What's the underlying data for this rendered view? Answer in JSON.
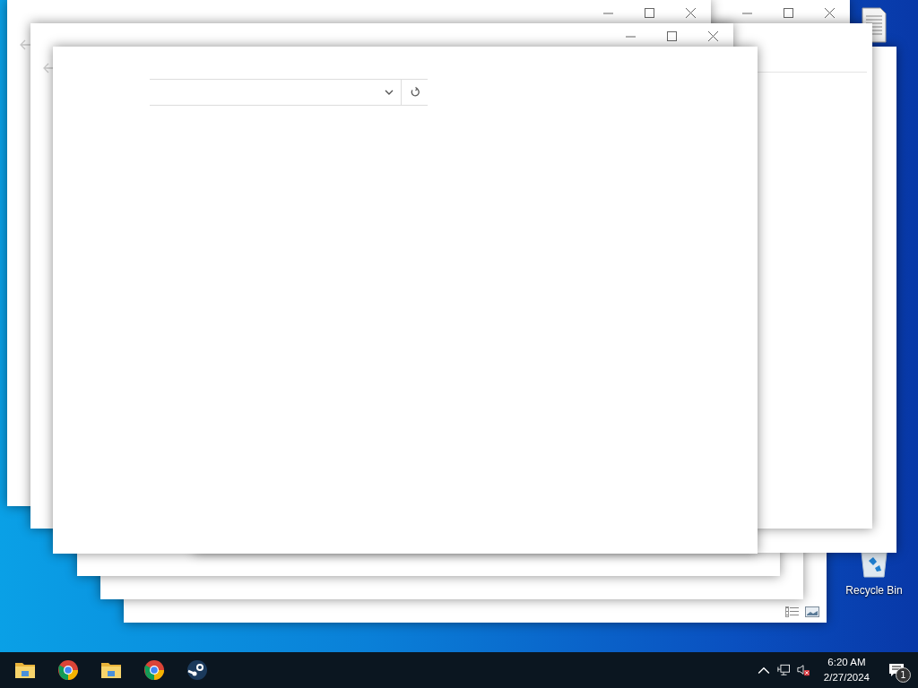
{
  "windows": [
    {
      "kind": "status"
    },
    {
      "kind": "plain"
    },
    {
      "kind": "plain"
    },
    {
      "kind": "plain"
    },
    {
      "kind": "controls"
    },
    {
      "kind": "address"
    },
    {
      "kind": "titled"
    },
    {
      "kind": "titled"
    },
    {
      "kind": "main"
    }
  ],
  "desktop": {
    "recycle_bin": {
      "label": "Recycle Bin"
    }
  },
  "taskbar": {
    "apps": [
      {
        "kind": "folder"
      },
      {
        "kind": "chrome"
      },
      {
        "kind": "folder"
      },
      {
        "kind": "chrome"
      },
      {
        "kind": "steam"
      }
    ],
    "clock": {
      "time": "6:20 AM",
      "date": "2/27/2024"
    },
    "notifications": {
      "count": "1"
    }
  }
}
